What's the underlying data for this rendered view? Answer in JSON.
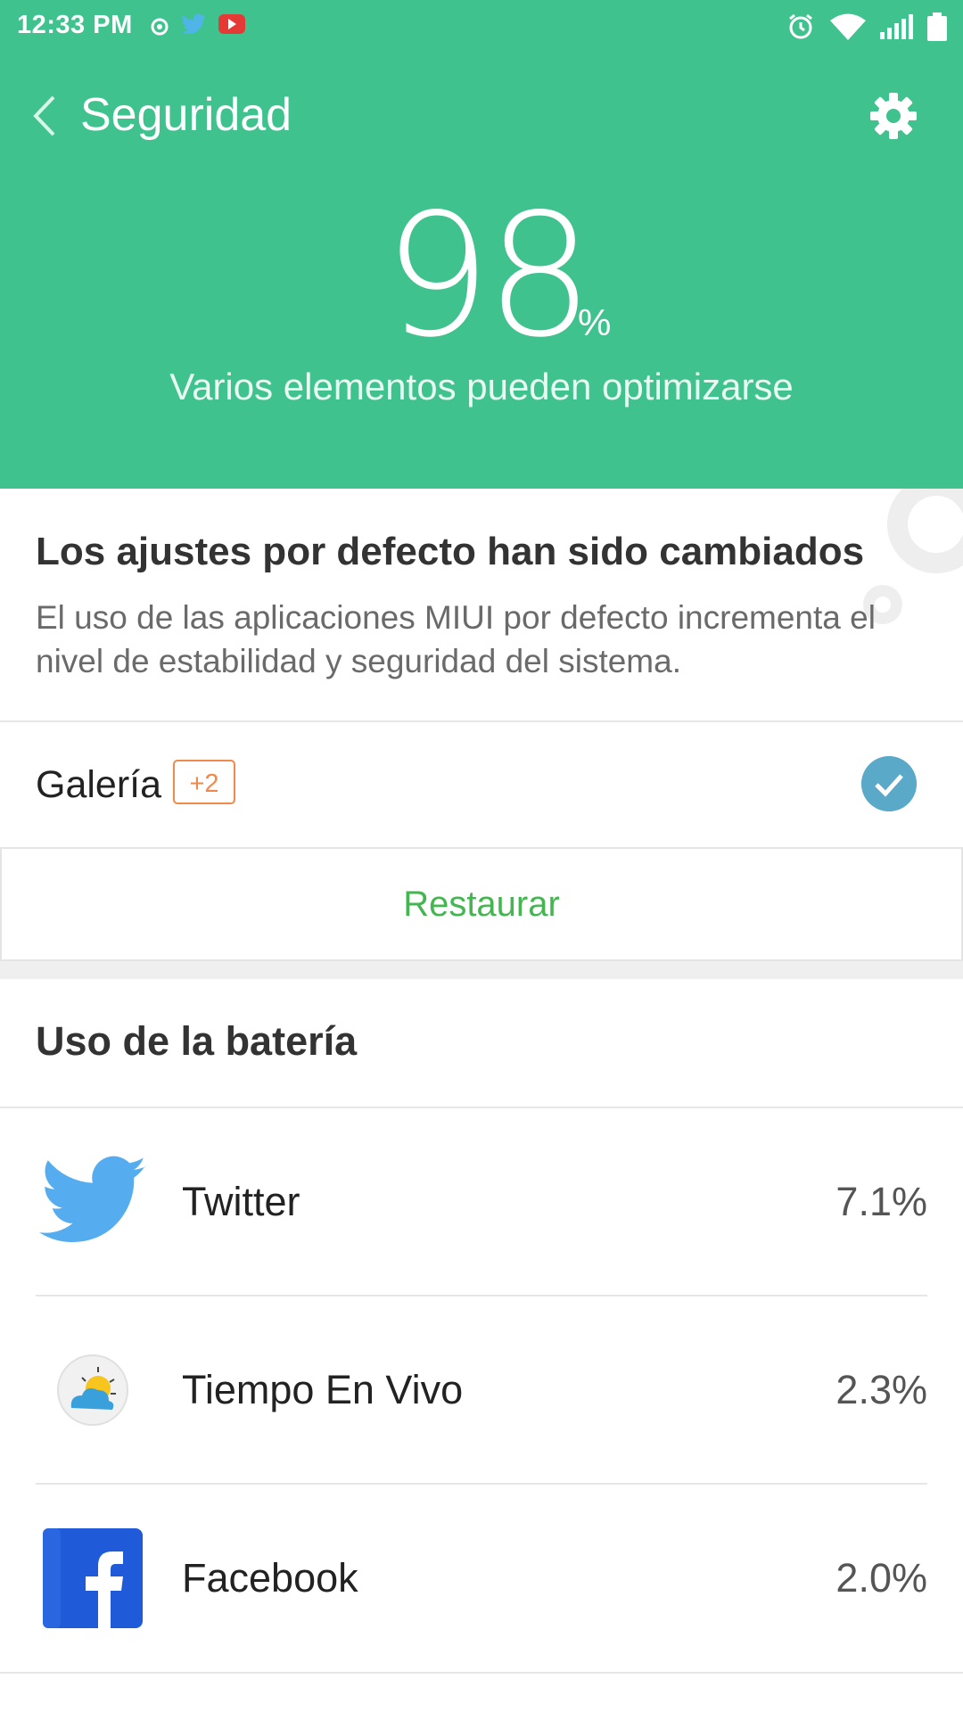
{
  "status_bar": {
    "time": "12:33 PM"
  },
  "header": {
    "title": "Seguridad",
    "score": "98",
    "score_unit": "%",
    "subtitle": "Varios elementos pueden optimizarse",
    "background_color": "#3fc28d"
  },
  "default_apps": {
    "title": "Los ajustes por defecto han sido cambiados",
    "description": "El uso de las aplicaciones MIUI por defecto incrementa el nivel de estabilidad y seguridad del sistema.",
    "item_label": "Galería",
    "item_badge": "+2",
    "item_checked": true,
    "restore_label": "Restaurar"
  },
  "battery": {
    "title": "Uso de la batería",
    "apps": [
      {
        "name": "Twitter",
        "percent": "7.1%",
        "icon": "twitter-icon"
      },
      {
        "name": "Tiempo En Vivo",
        "percent": "2.3%",
        "icon": "weather-icon"
      },
      {
        "name": "Facebook",
        "percent": "2.0%",
        "icon": "facebook-icon"
      }
    ]
  },
  "colors": {
    "accent_green": "#3fc28d",
    "restore_text": "#45b552",
    "badge_orange": "#f08a4b",
    "check_blue": "#5aa9c9"
  }
}
